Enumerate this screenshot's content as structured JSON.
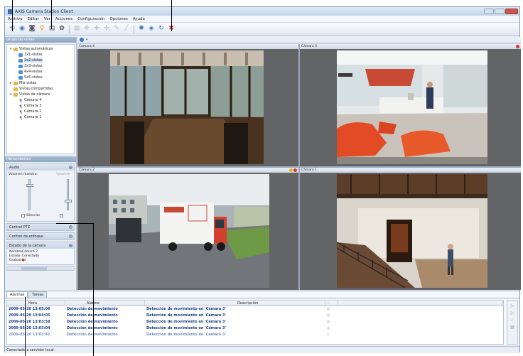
{
  "window": {
    "title": "AXIS Camera Station Client"
  },
  "menu": [
    "Archivo",
    "Editar",
    "Ver",
    "Acciones",
    "Configuración",
    "Opciones",
    "Ayuda"
  ],
  "toolbar": {
    "icons": [
      "back-icon",
      "live-view-icon",
      "camera-icon",
      "alarm-bell-icon",
      "document-icon",
      "settings-gear-icon",
      "add-view-icon",
      "ptz-icon",
      "focus-icon",
      "record-icon",
      "snapshot-icon",
      "draw-icon",
      "network-icon",
      "sequence-icon",
      "refresh-icon",
      "close-red-icon"
    ]
  },
  "sidebar": {
    "views_header": "Grupo de vistas",
    "tree": [
      {
        "label": "Vistas automáticas",
        "level": 0,
        "icon": "folder"
      },
      {
        "label": "1x1-vistas",
        "level": 1,
        "icon": "view"
      },
      {
        "label": "2x2-vistas",
        "level": 1,
        "icon": "view",
        "selected": true
      },
      {
        "label": "3x3-vistas",
        "level": 1,
        "icon": "view"
      },
      {
        "label": "4x4-vistas",
        "level": 1,
        "icon": "view"
      },
      {
        "label": "5x5-vistas",
        "level": 1,
        "icon": "view"
      },
      {
        "label": "Mis vistas",
        "level": 0,
        "icon": "folder"
      },
      {
        "label": "Vistas compartidas",
        "level": 0,
        "icon": "folder"
      },
      {
        "label": "Vistas de cámara",
        "level": 0,
        "icon": "folder"
      },
      {
        "label": "Cámara 4",
        "level": 1,
        "icon": "cam"
      },
      {
        "label": "Cámara 3",
        "level": 1,
        "icon": "cam"
      },
      {
        "label": "Cámara 2",
        "level": 1,
        "icon": "cam"
      },
      {
        "label": "Cámara 1",
        "level": 1,
        "icon": "cam"
      }
    ],
    "tools_header": "Herramientas",
    "audio": {
      "title": "Audio",
      "master_volume": "Volumen maestro:",
      "volume": "Volumen",
      "mute": "Silenciar"
    },
    "sections": [
      "Control PTZ",
      "Control de enfoque",
      "Estado de la cámara"
    ],
    "camera_status": {
      "name_label": "Nombre:",
      "name_value": "Cámara 2",
      "state_label": "Estado:",
      "state_value": "Conectado",
      "recording_label": "Grabación:"
    }
  },
  "cameras": [
    {
      "label": "Cámara 4"
    },
    {
      "label": "Cámara 3"
    },
    {
      "label": "Cámara 2"
    },
    {
      "label": "Cámara 1"
    }
  ],
  "alarms": {
    "tabs": [
      "Alarmas",
      "Tareas"
    ],
    "columns": [
      "Hora",
      "Alarma",
      "Descripción"
    ],
    "rows": [
      {
        "time": "2009-05-20 13:05:06",
        "alarm": "Detección de movimiento",
        "desc": "Detección de movimiento en 'Cámara 3'"
      },
      {
        "time": "2009-05-20 13:04:05",
        "alarm": "Detección de movimiento",
        "desc": "Detección de movimiento en 'Cámara 3'"
      },
      {
        "time": "2009-05-20 13:03:58",
        "alarm": "Detección de movimiento",
        "desc": "Detección de movimiento en 'Cámara 3'"
      },
      {
        "time": "2009-05-20 13:03:04",
        "alarm": "Detección de movimiento",
        "desc": "Detección de movimiento en 'Cámara 3'"
      },
      {
        "time": "2009-05-20 13:02:41",
        "alarm": "Detección de movimiento",
        "desc": "Detección de movimiento en 'Cámara 3'"
      }
    ]
  },
  "statusbar": {
    "text": "Conectado a servidor local"
  },
  "colors": {
    "accent": "#3c78c4",
    "alarm_text": "#163a8c",
    "recording": "#cc2233"
  }
}
